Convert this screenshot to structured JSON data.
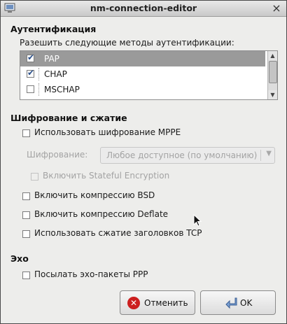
{
  "window": {
    "title": "nm-connection-editor"
  },
  "auth": {
    "title": "Аутентификация",
    "hint": "Разешить следующие методы аутентификации:",
    "methods": [
      {
        "label": "PAP",
        "checked": true,
        "selected": true
      },
      {
        "label": "CHAP",
        "checked": true,
        "selected": false
      },
      {
        "label": "MSCHAP",
        "checked": false,
        "selected": false
      }
    ]
  },
  "encryption": {
    "title": "Шифрование и сжатие",
    "use_mppe": "Использовать шифрование MPPE",
    "cipher_label": "Шифрование:",
    "cipher_value": "Любое доступное (по умолчанию)",
    "stateful": "Включить Stateful Encryption",
    "bsd": "Включить компрессию BSD",
    "deflate": "Включить компрессию Deflate",
    "tcp_header": "Использовать сжатие заголовков TCP"
  },
  "echo": {
    "title": "Эхо",
    "send_ppp": "Посылать эхо-пакеты PPP"
  },
  "buttons": {
    "cancel": "Отменить",
    "ok": "OK"
  }
}
